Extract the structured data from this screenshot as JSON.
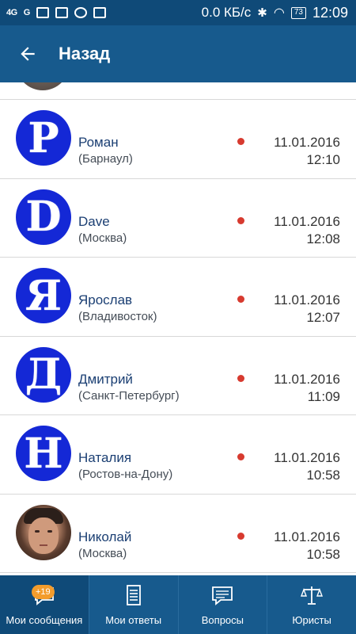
{
  "statusbar": {
    "signal1": "4G",
    "signal2": "G",
    "speed": "0.0 КБ/с",
    "battery": "73",
    "time": "12:09"
  },
  "appbar": {
    "title": "Назад",
    "back_icon": "arrow-left-icon"
  },
  "messages": [
    {
      "avatar_letter": "Р",
      "avatar_type": "letter",
      "name": "Роман",
      "city": "(Барнаул)",
      "date": "11.01.2016",
      "time": "12:10",
      "unread": true
    },
    {
      "avatar_letter": "D",
      "avatar_type": "letter",
      "name": "Dave",
      "city": "(Москва)",
      "date": "11.01.2016",
      "time": "12:08",
      "unread": true
    },
    {
      "avatar_letter": "Я",
      "avatar_type": "letter",
      "name": "Ярослав",
      "city": "(Владивосток)",
      "date": "11.01.2016",
      "time": "12:07",
      "unread": true
    },
    {
      "avatar_letter": "Д",
      "avatar_type": "letter",
      "name": "Дмитрий",
      "city": "(Санкт-Петербург)",
      "date": "11.01.2016",
      "time": "11:09",
      "unread": true
    },
    {
      "avatar_letter": "Н",
      "avatar_type": "letter",
      "name": "Наталия",
      "city": "(Ростов-на-Дону)",
      "date": "11.01.2016",
      "time": "10:58",
      "unread": true
    },
    {
      "avatar_letter": "",
      "avatar_type": "photo",
      "name": "Николай",
      "city": "(Москва)",
      "date": "11.01.2016",
      "time": "10:58",
      "unread": true
    }
  ],
  "bottomnav": {
    "items": [
      {
        "label": "Мои сообщения",
        "icon": "chat-icon",
        "badge": "+19",
        "active": true
      },
      {
        "label": "Мои ответы",
        "icon": "document-icon"
      },
      {
        "label": "Вопросы",
        "icon": "message-icon"
      },
      {
        "label": "Юристы",
        "icon": "scales-icon"
      }
    ]
  },
  "colors": {
    "statusbar": "#0f4a78",
    "appbar": "#175a8d",
    "avatar": "#1428d6",
    "unread_dot": "#d73a2f",
    "badge": "#f39c2c"
  }
}
